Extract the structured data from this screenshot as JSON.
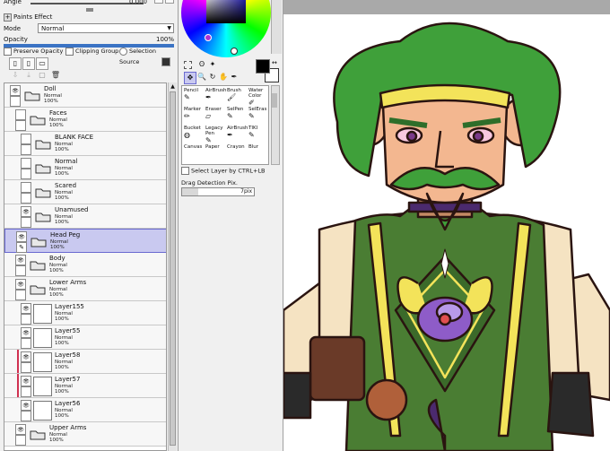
{
  "left_panel": {
    "top_label": "Angle",
    "top_value": "0.000",
    "paints_effect": "Paints Effect",
    "mode_label": "Mode",
    "mode_value": "Normal",
    "opacity_label": "Opacity",
    "opacity_value": "100%",
    "preserve_opacity": "Preserve Opacity",
    "clipping_group": "Clipping Group",
    "selection_source": "Selection Source"
  },
  "layers": [
    {
      "name": "Doll",
      "mode": "Normal",
      "opacity": "100%",
      "kind": "folder",
      "indent": 0,
      "visible": true,
      "selected": false
    },
    {
      "name": "Faces",
      "mode": "Normal",
      "opacity": "100%",
      "kind": "folder",
      "indent": 1,
      "visible": false,
      "selected": false
    },
    {
      "name": "BLANK FACE",
      "mode": "Normal",
      "opacity": "100%",
      "kind": "folder",
      "indent": 2,
      "visible": false,
      "selected": false
    },
    {
      "name": "Normal",
      "mode": "Normal",
      "opacity": "100%",
      "kind": "folder",
      "indent": 2,
      "visible": false,
      "selected": false
    },
    {
      "name": "Scared",
      "mode": "Normal",
      "opacity": "100%",
      "kind": "folder",
      "indent": 2,
      "visible": false,
      "selected": false
    },
    {
      "name": "Unamused",
      "mode": "Normal",
      "opacity": "100%",
      "kind": "folder",
      "indent": 2,
      "visible": true,
      "selected": false
    },
    {
      "name": "Head Peg",
      "mode": "Normal",
      "opacity": "100%",
      "kind": "folder",
      "indent": 1,
      "visible": true,
      "selected": true
    },
    {
      "name": "Body",
      "mode": "Normal",
      "opacity": "100%",
      "kind": "folder",
      "indent": 1,
      "visible": true,
      "selected": false
    },
    {
      "name": "Lower Arms",
      "mode": "Normal",
      "opacity": "100%",
      "kind": "folder",
      "indent": 1,
      "visible": true,
      "selected": false
    },
    {
      "name": "Layer155",
      "mode": "Normal",
      "opacity": "100%",
      "kind": "layer",
      "indent": 2,
      "visible": true,
      "selected": false
    },
    {
      "name": "Layer55",
      "mode": "Normal",
      "opacity": "100%",
      "kind": "layer",
      "indent": 2,
      "visible": true,
      "selected": false
    },
    {
      "name": "Layer58",
      "mode": "Normal",
      "opacity": "100%",
      "kind": "layer",
      "indent": 2,
      "visible": true,
      "selected": false,
      "clip": true
    },
    {
      "name": "Layer57",
      "mode": "Normal",
      "opacity": "100%",
      "kind": "layer",
      "indent": 2,
      "visible": true,
      "selected": false,
      "clip": true
    },
    {
      "name": "Layer56",
      "mode": "Normal",
      "opacity": "100%",
      "kind": "layer",
      "indent": 2,
      "visible": true,
      "selected": false
    },
    {
      "name": "Upper Arms",
      "mode": "Normal",
      "opacity": "100%",
      "kind": "folder",
      "indent": 1,
      "visible": true,
      "selected": false
    }
  ],
  "tools": [
    {
      "label": "Pencil",
      "icon": "pencil-icon",
      "glyph": "✎"
    },
    {
      "label": "AirBrush",
      "icon": "airbrush-icon",
      "glyph": "✒"
    },
    {
      "label": "Brush",
      "icon": "brush-icon",
      "glyph": "🖌"
    },
    {
      "label": "Water Color",
      "icon": "watercolor-icon",
      "glyph": "✐"
    },
    {
      "label": "Marker",
      "icon": "marker-icon",
      "glyph": "✏"
    },
    {
      "label": "Eraser",
      "icon": "eraser-icon",
      "glyph": "▱"
    },
    {
      "label": "SelPen",
      "icon": "selpen-icon",
      "glyph": "✎"
    },
    {
      "label": "SelEras",
      "icon": "seleras-icon",
      "glyph": "✎"
    },
    {
      "label": "Bucket",
      "icon": "bucket-icon",
      "glyph": "◍"
    },
    {
      "label": "Legacy Pen",
      "icon": "legacy-pen-icon",
      "glyph": "✎"
    },
    {
      "label": "AirBrush",
      "icon": "airbrush-icon",
      "glyph": "✒"
    },
    {
      "label": "TIKI",
      "icon": "tiki-icon",
      "glyph": "✎"
    },
    {
      "label": "Canvas",
      "icon": "canvas-icon",
      "glyph": ""
    },
    {
      "label": "Paper",
      "icon": "paper-icon",
      "glyph": ""
    },
    {
      "label": "Crayon",
      "icon": "crayon-icon",
      "glyph": ""
    },
    {
      "label": "Blur",
      "icon": "blur-icon",
      "glyph": ""
    }
  ],
  "mid_panel": {
    "select_layer_label": "Select Layer by CTRL+LB",
    "drag_detection_label": "Drag Detection Pix.",
    "drag_detection_value": "7pix"
  },
  "colors": {
    "foreground": "#000000",
    "background": "#ffffff",
    "selection": "#c9c9f0",
    "hair": "#3fa03a",
    "skin": "#f3b790",
    "tunic": "#4a7d33",
    "trim": "#f3e35a",
    "undershirt": "#f5e3c2",
    "eye_purple": "#8e5cc8"
  }
}
